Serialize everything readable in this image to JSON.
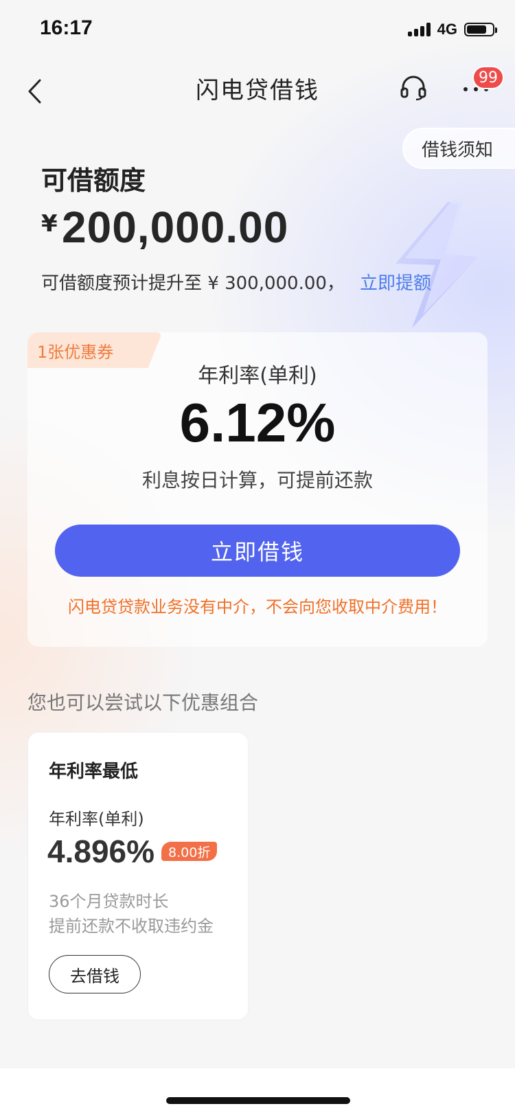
{
  "status_bar": {
    "time": "16:17",
    "network": "4G",
    "battery_level": 0.78
  },
  "nav": {
    "title": "闪电贷借钱",
    "badge_count": "99"
  },
  "notice_label": "借钱须知",
  "credit": {
    "label": "可借额度",
    "currency": "¥",
    "amount": "200,000.00",
    "hint": "可借额度预计提升至 ¥ 300,000.00，",
    "link": "立即提额"
  },
  "main_card": {
    "coupon": "1张优惠券",
    "rate_label": "年利率(单利)",
    "rate_value": "6.12%",
    "rate_note": "利息按日计算，可提前还款",
    "button": "立即借钱",
    "warning": "闪电贷贷款业务没有中介，不会向您收取中介费用！"
  },
  "section_title": "您也可以尝试以下优惠组合",
  "offer": {
    "title": "年利率最低",
    "rate_label": "年利率(单利)",
    "rate": "4.896%",
    "discount": "8.00折",
    "term": "36个月贷款时长",
    "prepay": "提前还款不收取违约金",
    "button": "去借钱"
  },
  "colors": {
    "primary_button": "#5163ef",
    "link": "#4e7dea",
    "warning": "#f07028",
    "badge": "#ee4b4b",
    "discount": "#f26f47"
  }
}
